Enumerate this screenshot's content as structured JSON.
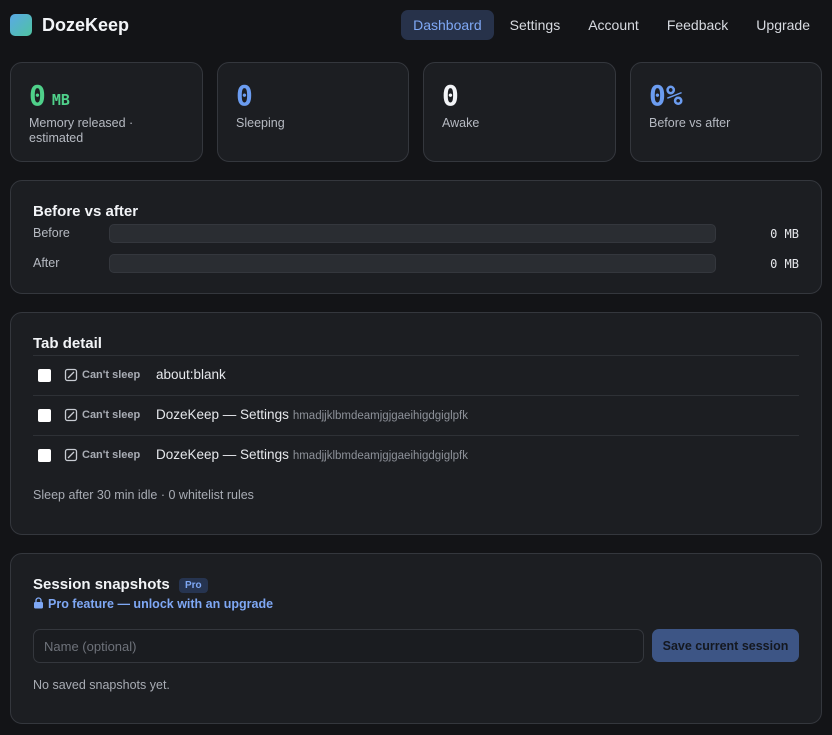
{
  "app": {
    "title": "DozeKeep"
  },
  "nav": [
    {
      "label": "Dashboard",
      "active": true
    },
    {
      "label": "Settings"
    },
    {
      "label": "Account"
    },
    {
      "label": "Feedback"
    },
    {
      "label": "Upgrade"
    }
  ],
  "stats": {
    "memory": {
      "value": "0",
      "unit": "MB",
      "label": "Memory released · estimated",
      "color": "#4fd08a"
    },
    "sleeping": {
      "value": "0",
      "label": "Sleeping",
      "color": "#6b9cf0"
    },
    "awake": {
      "value": "0",
      "label": "Awake",
      "color": "#f2f4f7"
    },
    "ratio": {
      "value": "0%",
      "label": "Before vs after",
      "color": "#6b9cf0"
    }
  },
  "before_after": {
    "title": "Before vs after",
    "rows": [
      {
        "label": "Before",
        "value": "0 MB",
        "fill": 0
      },
      {
        "label": "After",
        "value": "0 MB",
        "fill": 0
      }
    ]
  },
  "tab_detail": {
    "title": "Tab detail",
    "tabs": [
      {
        "badge": "Can't sleep",
        "title": "about:blank",
        "subtitle": ""
      },
      {
        "badge": "Can't sleep",
        "title": "DozeKeep — Settings",
        "subtitle": "hmadjjklbmdeamjgjgaeihigdgiglpfk"
      },
      {
        "badge": "Can't sleep",
        "title": "DozeKeep — Settings",
        "subtitle": "hmadjjklbmdeamjgjgaeihigdgiglpfk"
      }
    ],
    "footer": "Sleep after 30 min idle · 0 whitelist rules"
  },
  "snapshots": {
    "title": "Session snapshots",
    "badge": "Pro",
    "pro_link": "Pro feature — unlock with an upgrade",
    "input_placeholder": "Name (optional)",
    "input_value": "",
    "save_label": "Save current session",
    "empty_text": "No saved snapshots yet."
  },
  "icons": {
    "logo": "app-logo-icon",
    "cant_sleep": "slash-circle-icon",
    "lock": "lock-icon"
  }
}
